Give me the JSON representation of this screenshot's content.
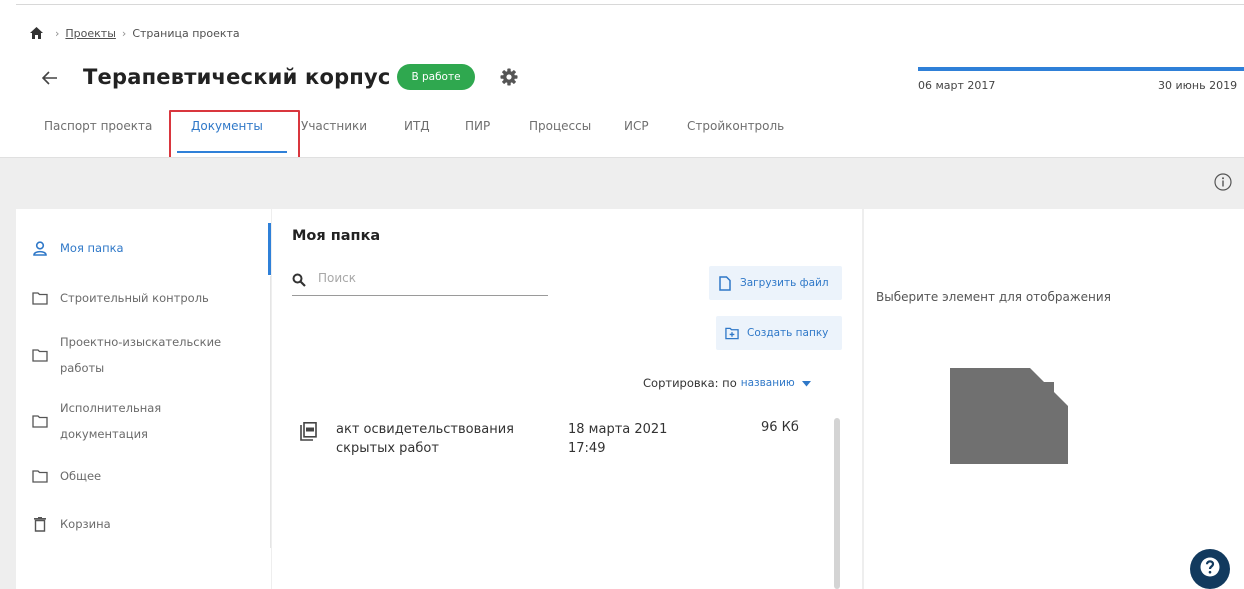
{
  "breadcrumb": {
    "home_icon": "home-icon",
    "separator": "›",
    "items": [
      "Проекты",
      "Страница проекта"
    ]
  },
  "project": {
    "title": "Терапевтический корпус",
    "status": "В работе",
    "status_color": "#2fa84f"
  },
  "timeline": {
    "start": "06 март 2017",
    "end": "30 июнь 2019"
  },
  "tabs": [
    {
      "label": "Паспорт проекта"
    },
    {
      "label": "Документы",
      "active": true
    },
    {
      "label": "Участники"
    },
    {
      "label": "ИТД"
    },
    {
      "label": "ПИР"
    },
    {
      "label": "Процессы"
    },
    {
      "label": "ИСР"
    },
    {
      "label": "Стройконтроль"
    }
  ],
  "sidebar": {
    "items": [
      {
        "label": "Моя папка",
        "icon": "user-icon",
        "active": true
      },
      {
        "label": "Строительный контроль",
        "icon": "folder-icon"
      },
      {
        "label_lines": [
          "Проектно-изыскательские",
          "работы"
        ],
        "icon": "folder-icon"
      },
      {
        "label_lines": [
          "Исполнительная",
          "документация"
        ],
        "icon": "folder-icon"
      },
      {
        "label": "Общее",
        "icon": "folder-icon"
      },
      {
        "label": "Корзина",
        "icon": "trash-icon"
      }
    ]
  },
  "main": {
    "title": "Моя папка",
    "search_placeholder": "Поиск",
    "upload_label": "Загрузить файл",
    "create_folder_label": "Создать папку",
    "sort_label": "Сортировка: по",
    "sort_value": "названию",
    "files": [
      {
        "name_lines": [
          "акт освидетельствования",
          "скрытых работ"
        ],
        "date_lines": [
          "18 марта 2021",
          "17:49"
        ],
        "size": "96 Кб",
        "icon": "pdf-file-icon"
      }
    ]
  },
  "preview": {
    "empty_text": "Выберите элемент для отображения",
    "icon": "empty-document-icon"
  },
  "colors": {
    "accent": "#2f80d8",
    "highlight": "#d9363e",
    "help_button": "#123a5e"
  }
}
